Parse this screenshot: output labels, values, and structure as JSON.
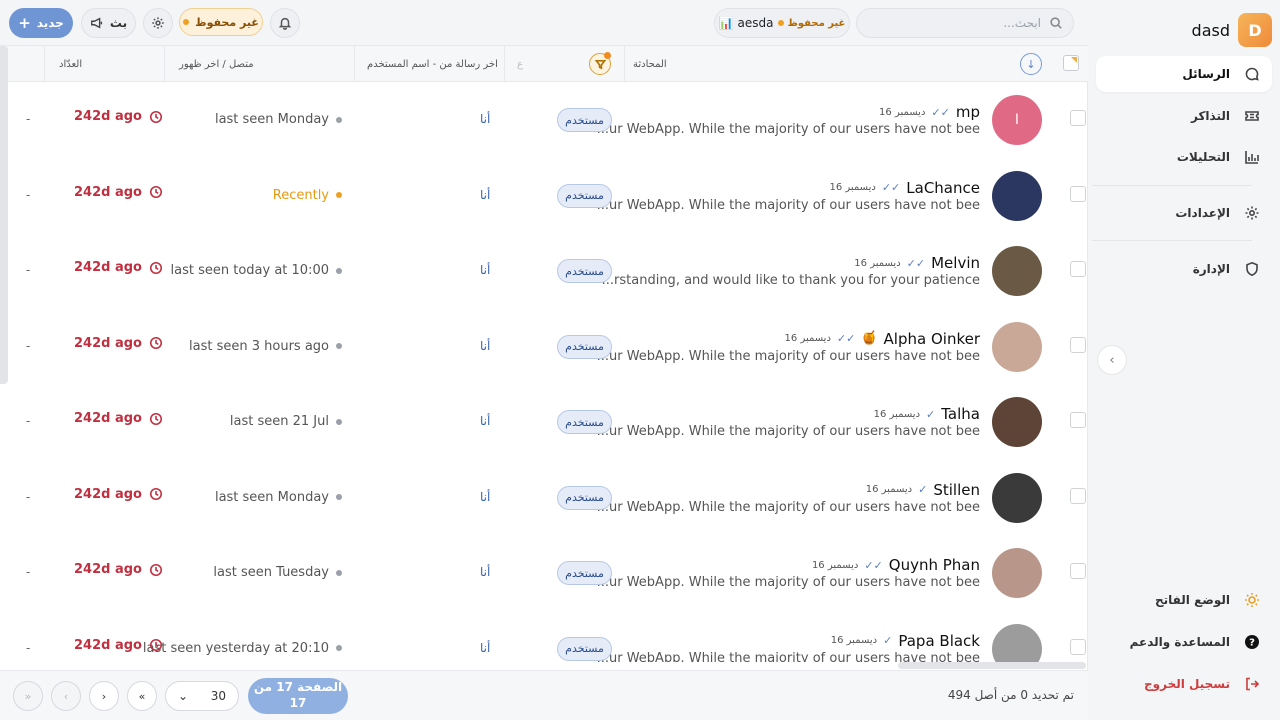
{
  "brand": {
    "logo_letter": "D",
    "name": "dasd"
  },
  "sidebar": {
    "items": [
      {
        "label": "الرسائل",
        "icon": "chat-icon",
        "active": true
      },
      {
        "label": "التذاكر",
        "icon": "ticket-icon"
      },
      {
        "label": "التحليلات",
        "icon": "analytics-icon"
      },
      {
        "label": "الإعدادات",
        "icon": "gear-icon"
      },
      {
        "label": "الإدارة",
        "icon": "shield-icon"
      }
    ],
    "bottom": [
      {
        "label": "الوضع الفاتح",
        "icon": "sun-icon"
      },
      {
        "label": "المساعدة والدعم",
        "icon": "help-icon"
      },
      {
        "label": "تسجيل الخروج",
        "icon": "logout-icon"
      }
    ]
  },
  "topbar": {
    "search_placeholder": "ابحث...",
    "workspace_name": "aesda",
    "workspace_status": "غير محفوظ",
    "unsaved_label": "غير محفوظ",
    "broadcast_label": "بث",
    "new_label": "جديد",
    "accent_color": "#6f95d4"
  },
  "table": {
    "headers": {
      "conversation": "المحادثة",
      "last_message_from": "اخر رسالة من - اسم المستخدم",
      "online_last_seen": "متصل / اخر ظهور",
      "counter": "العدّاد",
      "sort_hint": "ع"
    },
    "rows": [
      {
        "name": "mp",
        "date": "16 ديسمبر",
        "ticks": "✓✓",
        "preview": "...ur WebApp. While the majority of our users have not bee",
        "badge": "مستخدم",
        "last_from": "أنا",
        "status": "last seen Monday",
        "counter": "242d ago",
        "extra": "-",
        "avatar_letter": "ا",
        "avatar_color": "#e06a86"
      },
      {
        "name": "LaChance",
        "date": "16 ديسمبر",
        "ticks": "✓✓",
        "preview": "...ur WebApp. While the majority of our users have not bee",
        "badge": "مستخدم",
        "last_from": "أنا",
        "status": "Recently",
        "counter": "242d ago",
        "extra": "-",
        "avatar_letter": "",
        "avatar_color": "#2b3760",
        "recent": true
      },
      {
        "name": "Melvin",
        "date": "16 ديسمبر",
        "ticks": "✓✓",
        "preview": "...rstanding, and would like to thank you for your patience",
        "badge": "مستخدم",
        "last_from": "أنا",
        "status": "last seen today at 10:00",
        "counter": "242d ago",
        "extra": "-",
        "avatar_letter": "",
        "avatar_color": "#6a5a45"
      },
      {
        "name": "Alpha Oinker",
        "date": "16 ديسمبر",
        "ticks": "✓✓",
        "preview": "...ur WebApp. While the majority of our users have not bee",
        "badge": "مستخدم",
        "last_from": "أنا",
        "status": "last seen 3 hours ago",
        "counter": "242d ago",
        "extra": "-",
        "avatar_letter": "",
        "avatar_color": "#c9a898",
        "emoji": "🍯"
      },
      {
        "name": "Talha",
        "date": "16 ديسمبر",
        "ticks": "✓",
        "preview": "...ur WebApp. While the majority of our users have not bee",
        "badge": "مستخدم",
        "last_from": "أنا",
        "status": "last seen 21 Jul",
        "counter": "242d ago",
        "extra": "-",
        "avatar_letter": "",
        "avatar_color": "#5d4436"
      },
      {
        "name": "Stillen",
        "date": "16 ديسمبر",
        "ticks": "✓",
        "preview": "...ur WebApp. While the majority of our users have not bee",
        "badge": "مستخدم",
        "last_from": "أنا",
        "status": "last seen Monday",
        "counter": "242d ago",
        "extra": "-",
        "avatar_letter": "",
        "avatar_color": "#3a3a3a"
      },
      {
        "name": "Quynh Phan",
        "date": "16 ديسمبر",
        "ticks": "✓✓",
        "preview": "...ur WebApp. While the majority of our users have not bee",
        "badge": "مستخدم",
        "last_from": "أنا",
        "status": "last seen Tuesday",
        "counter": "242d ago",
        "extra": "-",
        "avatar_letter": "",
        "avatar_color": "#b8978a"
      },
      {
        "name": "Papa Black",
        "date": "16 ديسمبر",
        "ticks": "✓",
        "preview": "...ur WebApp. While the majority of our users have not bee",
        "badge": "مستخدم",
        "last_from": "أنا",
        "status": "last seen yesterday at 20:10",
        "counter": "242d ago",
        "extra": "-",
        "avatar_letter": "",
        "avatar_color": "#9c9c9c"
      }
    ]
  },
  "footer": {
    "selection_text": "تم تحديد 0 من أصل 494",
    "per_page": "30",
    "page_label": "الصفحة 17 من 17",
    "first": "«",
    "prev": "‹",
    "next": "›",
    "last": "»"
  }
}
